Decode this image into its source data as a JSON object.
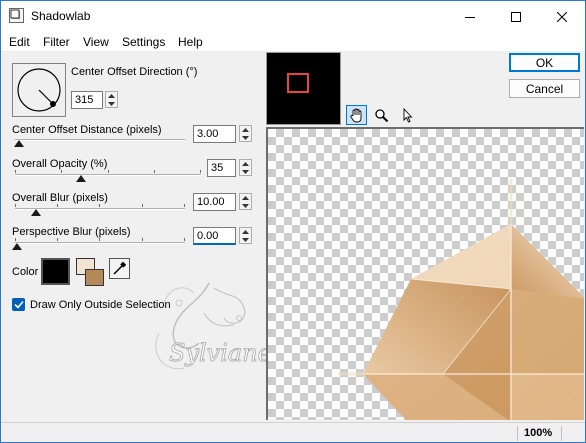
{
  "window": {
    "title": "Shadowlab"
  },
  "menu": [
    "Edit",
    "Filter",
    "View",
    "Settings",
    "Help"
  ],
  "controls": {
    "direction": {
      "label": "Center Offset Direction (°)",
      "value": "315"
    },
    "distance": {
      "label": "Center Offset Distance (pixels)",
      "value": "3.00"
    },
    "opacity": {
      "label": "Overall Opacity (%)",
      "value": "35"
    },
    "blur": {
      "label": "Overall Blur (pixels)",
      "value": "10.00"
    },
    "perspective": {
      "label": "Perspective Blur (pixels)",
      "value": "0.00"
    },
    "color": {
      "label": "Color",
      "value": "#000000",
      "secondary": "#b58a5a",
      "tertiary": "#f3e3d3"
    },
    "draw_outside": {
      "label": "Draw Only Outside Selection",
      "checked": true
    }
  },
  "buttons": {
    "ok": "OK",
    "cancel": "Cancel"
  },
  "status": {
    "zoom": "100%"
  },
  "watermark_text": "Sylviane",
  "icons": [
    "app-icon",
    "minimize-icon",
    "maximize-icon",
    "close-icon",
    "hand-icon",
    "zoom-icon",
    "pointer-icon",
    "eyedropper-icon",
    "checkmark-icon"
  ],
  "colors": {
    "accent": "#0078d7",
    "preview_frame": "#e8453c",
    "shape_light": "#f3dcc2",
    "shape_dark": "#c9955d"
  }
}
